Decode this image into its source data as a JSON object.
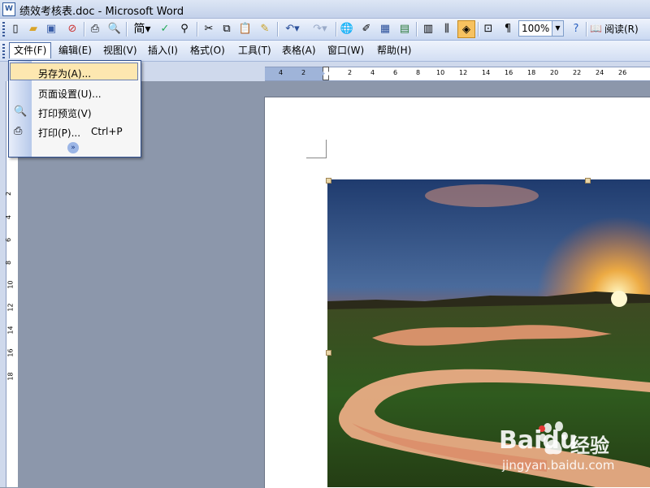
{
  "window": {
    "title": "绩效考核表.doc - Microsoft Word",
    "doc_icon": "W"
  },
  "toolbar": {
    "zoom_value": "100%",
    "read_label": "阅读(R)",
    "icons": [
      "new-doc-icon",
      "open-icon",
      "save-icon",
      "permission-icon",
      "print-icon",
      "print-preview-icon",
      "simplified-traditional-icon",
      "spelling-icon",
      "research-icon",
      "cut-icon",
      "copy-icon",
      "paste-icon",
      "format-painter-icon",
      "undo-icon",
      "redo-icon",
      "hyperlink-icon",
      "tables-borders-icon",
      "insert-table-icon",
      "insert-excel-icon",
      "columns-icon",
      "drawing-icon",
      "document-map-icon",
      "show-hide-icon",
      "help-icon"
    ]
  },
  "menubar": {
    "items": [
      {
        "label": "文件(F)"
      },
      {
        "label": "编辑(E)"
      },
      {
        "label": "视图(V)"
      },
      {
        "label": "插入(I)"
      },
      {
        "label": "格式(O)"
      },
      {
        "label": "工具(T)"
      },
      {
        "label": "表格(A)"
      },
      {
        "label": "窗口(W)"
      },
      {
        "label": "帮助(H)"
      }
    ]
  },
  "file_menu": {
    "items": [
      {
        "label": "另存为(A)...",
        "shortcut": ""
      },
      {
        "label": "页面设置(U)...",
        "shortcut": ""
      },
      {
        "label": "打印预览(V)",
        "shortcut": ""
      },
      {
        "label": "打印(P)...",
        "shortcut": "Ctrl+P"
      }
    ],
    "expand_glyph": "»"
  },
  "ruler": {
    "h_numbers": [
      "4",
      "2",
      "2",
      "4",
      "6",
      "8",
      "10",
      "12",
      "14",
      "16",
      "18",
      "20",
      "22",
      "24",
      "26"
    ],
    "v_numbers": [
      "2",
      "4",
      "6",
      "8",
      "10",
      "12",
      "14",
      "16",
      "18"
    ]
  },
  "watermark": {
    "brand": "Baidu",
    "suffix": "经验",
    "url": "jingyan.baidu.com"
  },
  "colors": {
    "accent": "#4f6fa8",
    "workspace": "#8c97ab",
    "highlight": "#fde7b0"
  }
}
